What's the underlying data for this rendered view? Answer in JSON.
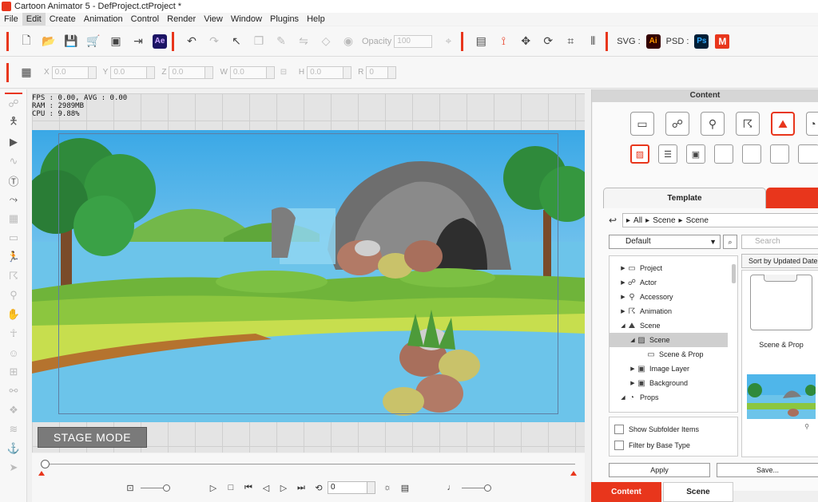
{
  "window": {
    "title": "Cartoon Animator 5 - DefProject.ctProject *"
  },
  "menu": [
    "File",
    "Edit",
    "Create",
    "Animation",
    "Control",
    "Render",
    "View",
    "Window",
    "Plugins",
    "Help"
  ],
  "toolbar": {
    "opacity_label": "Opacity",
    "opacity_value": "100",
    "svg_label": "SVG :",
    "psd_label": "PSD :",
    "ae_badge": "Ae",
    "ai_badge": "Ai",
    "ps_badge": "Ps",
    "m_badge": "M"
  },
  "transform": {
    "x_label": "X",
    "x_value": "0.0",
    "y_label": "Y",
    "y_value": "0.0",
    "z_label": "Z",
    "z_value": "0.0",
    "w_label": "W",
    "w_value": "0.0",
    "h_label": "H",
    "h_value": "0.0",
    "r_label": "R",
    "r_value": "0"
  },
  "stage": {
    "stats": "FPS : 0.00, AVG : 0.00\nRAM : 2989MB\nCPU : 9.88%",
    "mode_button": "STAGE MODE"
  },
  "timeline": {
    "frame_value": "0"
  },
  "content_panel": {
    "title": "Content",
    "tab_template": "Template",
    "breadcrumb": [
      "All",
      "Scene",
      "Scene"
    ],
    "filter_dropdown": "Default",
    "search_placeholder": "Search",
    "sort_button": "Sort by Updated Date",
    "tree": [
      {
        "label": "Project",
        "icon": "folder-icon",
        "level": 1,
        "expanded": false
      },
      {
        "label": "Actor",
        "icon": "actor-icon",
        "level": 1,
        "expanded": false
      },
      {
        "label": "Accessory",
        "icon": "accessory-icon",
        "level": 1,
        "expanded": false
      },
      {
        "label": "Animation",
        "icon": "animation-icon",
        "level": 1,
        "expanded": false
      },
      {
        "label": "Scene",
        "icon": "scene-icon",
        "level": 1,
        "expanded": true
      },
      {
        "label": "Scene",
        "icon": "scene-image-icon",
        "level": 2,
        "expanded": true,
        "selected": true
      },
      {
        "label": "Scene & Prop",
        "icon": "folder-icon",
        "level": 3,
        "expanded": false
      },
      {
        "label": "Image Layer",
        "icon": "image-icon",
        "level": 2,
        "expanded": false
      },
      {
        "label": "Background",
        "icon": "image-icon",
        "level": 2,
        "expanded": false
      },
      {
        "label": "Props",
        "icon": "props-icon",
        "level": 1,
        "expanded": true
      }
    ],
    "grid_items": [
      {
        "label": "Scene & Prop",
        "type": "folder"
      },
      {
        "label": "",
        "type": "scene-thumbnail"
      }
    ],
    "options": {
      "show_subfolder": "Show Subfolder Items",
      "filter_base": "Filter by Base Type"
    },
    "apply_button": "Apply",
    "save_button": "Save..."
  },
  "bottom_tabs": {
    "content": "Content",
    "scene": "Scene"
  },
  "colors": {
    "accent": "#e8361c",
    "sky": "#4fb6ea",
    "water": "#6cc4ea",
    "grass": "#8cc63f"
  }
}
